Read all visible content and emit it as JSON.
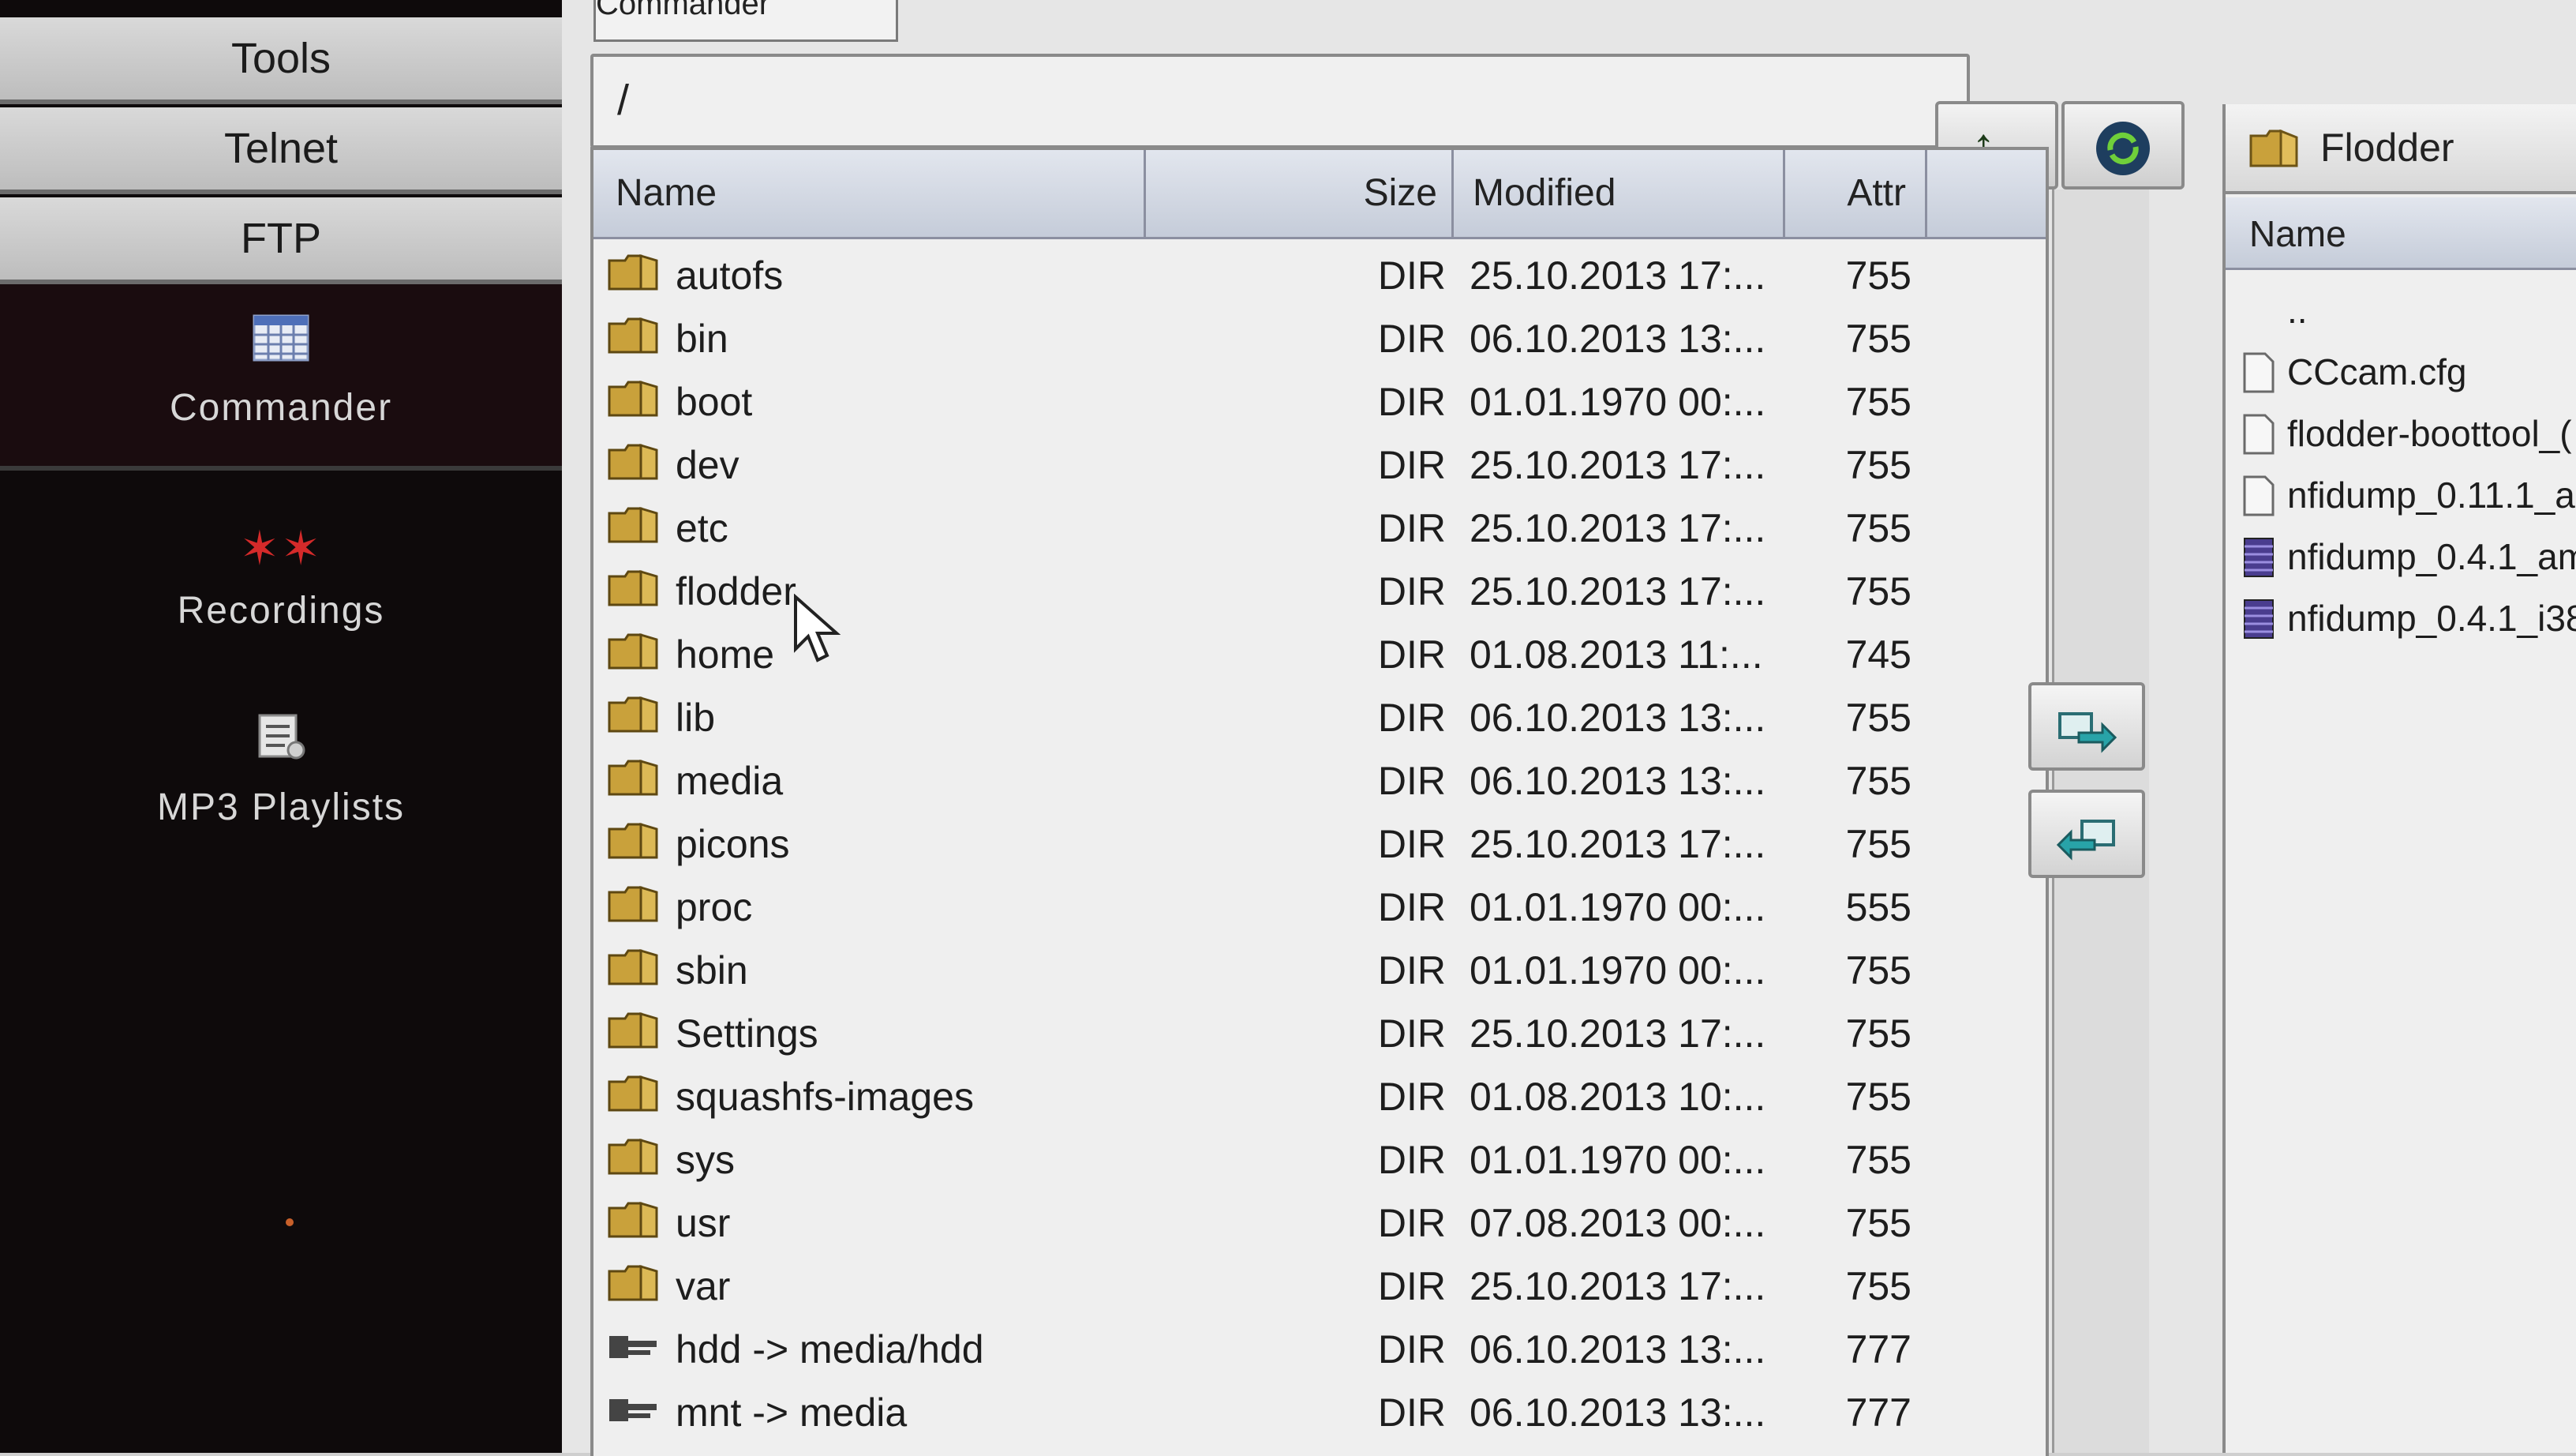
{
  "sidebar": {
    "menu": [
      {
        "label": "Tools"
      },
      {
        "label": "Telnet"
      },
      {
        "label": "FTP"
      }
    ],
    "apps": [
      {
        "label": "Commander",
        "icon": "grid-icon"
      },
      {
        "label": "Recordings",
        "icon": "recordings-icon"
      },
      {
        "label": "MP3 Playlists",
        "icon": "playlist-icon"
      }
    ]
  },
  "main": {
    "tab_label": "Commander",
    "path": "/",
    "toolbar": {
      "up_label": "↑..",
      "refresh_icon": "refresh-icon"
    },
    "columns": {
      "name": "Name",
      "size": "Size",
      "modified": "Modified",
      "attr": "Attr"
    },
    "rows": [
      {
        "name": "autofs",
        "type": "folder",
        "size": "DIR",
        "modified": "25.10.2013 17:...",
        "attr": "755"
      },
      {
        "name": "bin",
        "type": "folder",
        "size": "DIR",
        "modified": "06.10.2013 13:...",
        "attr": "755"
      },
      {
        "name": "boot",
        "type": "folder",
        "size": "DIR",
        "modified": "01.01.1970 00:...",
        "attr": "755"
      },
      {
        "name": "dev",
        "type": "folder",
        "size": "DIR",
        "modified": "25.10.2013 17:...",
        "attr": "755"
      },
      {
        "name": "etc",
        "type": "folder",
        "size": "DIR",
        "modified": "25.10.2013 17:...",
        "attr": "755"
      },
      {
        "name": "flodder",
        "type": "folder",
        "size": "DIR",
        "modified": "25.10.2013 17:...",
        "attr": "755"
      },
      {
        "name": "home",
        "type": "folder",
        "size": "DIR",
        "modified": "01.08.2013 11:...",
        "attr": "745"
      },
      {
        "name": "lib",
        "type": "folder",
        "size": "DIR",
        "modified": "06.10.2013 13:...",
        "attr": "755"
      },
      {
        "name": "media",
        "type": "folder",
        "size": "DIR",
        "modified": "06.10.2013 13:...",
        "attr": "755"
      },
      {
        "name": "picons",
        "type": "folder",
        "size": "DIR",
        "modified": "25.10.2013 17:...",
        "attr": "755"
      },
      {
        "name": "proc",
        "type": "folder",
        "size": "DIR",
        "modified": "01.01.1970 00:...",
        "attr": "555"
      },
      {
        "name": "sbin",
        "type": "folder",
        "size": "DIR",
        "modified": "01.01.1970 00:...",
        "attr": "755"
      },
      {
        "name": "Settings",
        "type": "folder",
        "size": "DIR",
        "modified": "25.10.2013 17:...",
        "attr": "755"
      },
      {
        "name": "squashfs-images",
        "type": "folder",
        "size": "DIR",
        "modified": "01.08.2013 10:...",
        "attr": "755"
      },
      {
        "name": "sys",
        "type": "folder",
        "size": "DIR",
        "modified": "01.01.1970 00:...",
        "attr": "755"
      },
      {
        "name": "usr",
        "type": "folder",
        "size": "DIR",
        "modified": "07.08.2013 00:...",
        "attr": "755"
      },
      {
        "name": "var",
        "type": "folder",
        "size": "DIR",
        "modified": "25.10.2013 17:...",
        "attr": "755"
      },
      {
        "name": "hdd -> media/hdd",
        "type": "link",
        "size": "DIR",
        "modified": "06.10.2013 13:...",
        "attr": "777"
      },
      {
        "name": "mnt -> media",
        "type": "link",
        "size": "DIR",
        "modified": "06.10.2013 13:...",
        "attr": "777"
      }
    ]
  },
  "right_panel": {
    "title": "Flodder",
    "column_name": "Name",
    "rows": [
      {
        "name": "..",
        "type": "parent"
      },
      {
        "name": "CCcam.cfg",
        "type": "file"
      },
      {
        "name": "flodder-boottool_(",
        "type": "file"
      },
      {
        "name": "nfidump_0.11.1_a",
        "type": "file"
      },
      {
        "name": "nfidump_0.4.1_am",
        "type": "archive"
      },
      {
        "name": "nfidump_0.4.1_i38",
        "type": "archive"
      }
    ]
  },
  "colors": {
    "sidebar_bg": "#0e0a0b",
    "header_bg": "#c5ccd9",
    "folder": "#c9a13b",
    "archive": "#4a3d8f"
  }
}
